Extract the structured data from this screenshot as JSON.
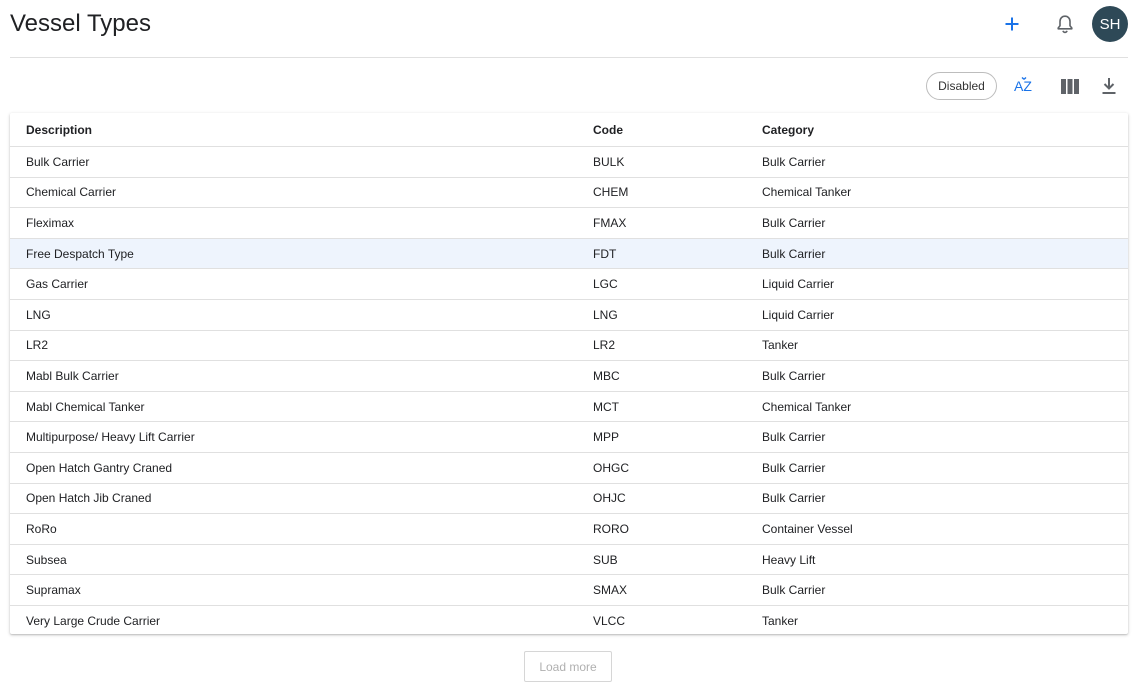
{
  "header": {
    "title": "Vessel Types",
    "avatar_initials": "SH",
    "accent_color": "#1a73e8",
    "avatar_color": "#2e4957",
    "icons": [
      "plus-icon",
      "bell-icon"
    ]
  },
  "toolbar": {
    "filter_chip": "Disabled",
    "sort_icon_text": "AZ",
    "icons": [
      "sort-az-icon",
      "columns-icon",
      "download-icon"
    ]
  },
  "table": {
    "columns": [
      "Description",
      "Code",
      "Category"
    ],
    "selected_row_index": 3,
    "selected_row_color": "#eef4fd",
    "rows": [
      {
        "description": "Bulk Carrier",
        "code": "BULK",
        "category": "Bulk Carrier"
      },
      {
        "description": "Chemical Carrier",
        "code": "CHEM",
        "category": "Chemical Tanker"
      },
      {
        "description": "Fleximax",
        "code": "FMAX",
        "category": "Bulk Carrier"
      },
      {
        "description": "Free Despatch Type",
        "code": "FDT",
        "category": "Bulk Carrier"
      },
      {
        "description": "Gas Carrier",
        "code": "LGC",
        "category": "Liquid Carrier"
      },
      {
        "description": "LNG",
        "code": "LNG",
        "category": "Liquid Carrier"
      },
      {
        "description": "LR2",
        "code": "LR2",
        "category": "Tanker"
      },
      {
        "description": "Mabl Bulk Carrier",
        "code": "MBC",
        "category": "Bulk Carrier"
      },
      {
        "description": "Mabl Chemical Tanker",
        "code": "MCT",
        "category": "Chemical Tanker"
      },
      {
        "description": "Multipurpose/ Heavy Lift Carrier",
        "code": "MPP",
        "category": "Bulk Carrier"
      },
      {
        "description": "Open Hatch Gantry Craned",
        "code": "OHGC",
        "category": "Bulk Carrier"
      },
      {
        "description": "Open Hatch Jib Craned",
        "code": "OHJC",
        "category": "Bulk Carrier"
      },
      {
        "description": "RoRo",
        "code": "RORO",
        "category": "Container Vessel"
      },
      {
        "description": "Subsea",
        "code": "SUB",
        "category": "Heavy Lift"
      },
      {
        "description": "Supramax",
        "code": "SMAX",
        "category": "Bulk Carrier"
      },
      {
        "description": "Very Large Crude Carrier",
        "code": "VLCC",
        "category": "Tanker"
      }
    ]
  },
  "footer": {
    "load_more_label": "Load more"
  }
}
